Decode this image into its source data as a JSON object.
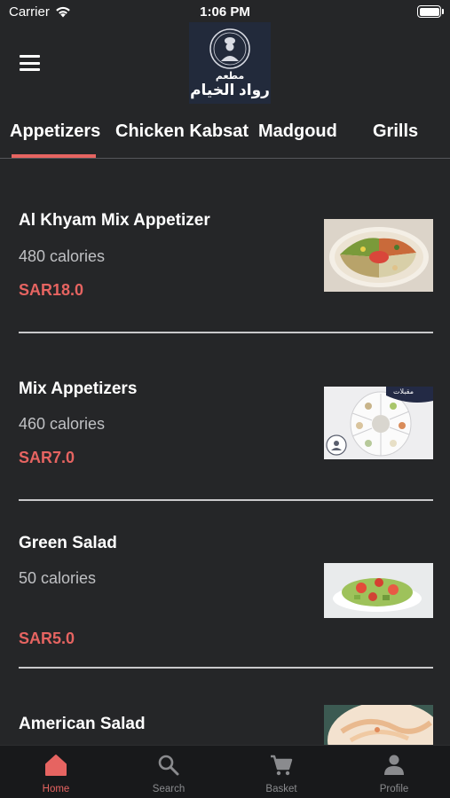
{
  "status_bar": {
    "carrier": "Carrier",
    "time": "1:06 PM"
  },
  "header": {
    "menu_icon": "hamburger-menu-icon",
    "logo_text_line1": "مطعم",
    "logo_text_line2": "رواد الخيام"
  },
  "tabs": [
    {
      "label": "Appetizers",
      "active": true
    },
    {
      "label": "Chicken Kabsat",
      "active": false
    },
    {
      "label": "Madgoud",
      "active": false
    },
    {
      "label": "Grills",
      "active": false
    }
  ],
  "items": [
    {
      "name": "Al Khyam Mix Appetizer",
      "calories": "480 calories",
      "price": "SAR18.0"
    },
    {
      "name": "Mix Appetizers",
      "calories": "460 calories",
      "price": "SAR7.0",
      "image_caption": "مقبلات"
    },
    {
      "name": "Green Salad",
      "calories": "50 calories",
      "price": "SAR5.0"
    },
    {
      "name": "American Salad"
    }
  ],
  "bottom_nav": [
    {
      "label": "Home",
      "icon": "home-icon",
      "active": true
    },
    {
      "label": "Search",
      "icon": "search-icon",
      "active": false
    },
    {
      "label": "Basket",
      "icon": "cart-icon",
      "active": false
    },
    {
      "label": "Profile",
      "icon": "person-icon",
      "active": false
    }
  ],
  "colors": {
    "accent": "#e66461",
    "background": "#252628",
    "tab_bar": "#18191b"
  }
}
